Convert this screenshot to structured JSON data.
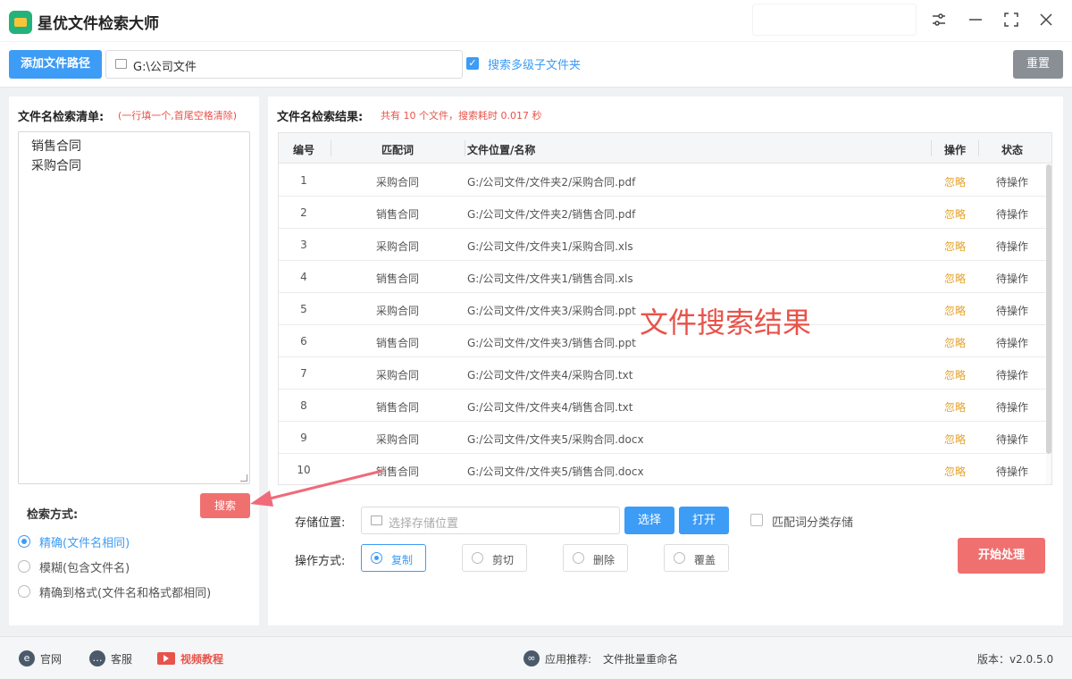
{
  "app": {
    "title": "星优文件检索大师"
  },
  "toolbar": {
    "add_path_label": "添加文件路径",
    "path_value": "G:\\公司文件",
    "subfolder_label": "搜索多级子文件夹",
    "subfolder_checked": true,
    "reset_label": "重置"
  },
  "left": {
    "title": "文件名检索清单:",
    "hint": "(一行填一个,首尾空格清除)",
    "keywords": [
      "销售合同",
      "采购合同"
    ],
    "search_label": "搜索",
    "mode_title": "检索方式:",
    "modes": [
      {
        "label": "精确(文件名相同)",
        "selected": true
      },
      {
        "label": "模糊(包含文件名)",
        "selected": false
      },
      {
        "label": "精确到格式(文件名和格式都相同)",
        "selected": false
      }
    ]
  },
  "results": {
    "title": "文件名检索结果:",
    "summary": "共有 10 个文件，搜索耗时 0.017 秒",
    "columns": [
      "编号",
      "匹配词",
      "文件位置/名称",
      "操作",
      "状态"
    ],
    "rows": [
      {
        "idx": "1",
        "kw": "采购合同",
        "path": "G:/公司文件/文件夹2/采购合同.pdf",
        "op": "忽略",
        "st": "待操作"
      },
      {
        "idx": "2",
        "kw": "销售合同",
        "path": "G:/公司文件/文件夹2/销售合同.pdf",
        "op": "忽略",
        "st": "待操作"
      },
      {
        "idx": "3",
        "kw": "采购合同",
        "path": "G:/公司文件/文件夹1/采购合同.xls",
        "op": "忽略",
        "st": "待操作"
      },
      {
        "idx": "4",
        "kw": "销售合同",
        "path": "G:/公司文件/文件夹1/销售合同.xls",
        "op": "忽略",
        "st": "待操作"
      },
      {
        "idx": "5",
        "kw": "采购合同",
        "path": "G:/公司文件/文件夹3/采购合同.ppt",
        "op": "忽略",
        "st": "待操作"
      },
      {
        "idx": "6",
        "kw": "销售合同",
        "path": "G:/公司文件/文件夹3/销售合同.ppt",
        "op": "忽略",
        "st": "待操作"
      },
      {
        "idx": "7",
        "kw": "采购合同",
        "path": "G:/公司文件/文件夹4/采购合同.txt",
        "op": "忽略",
        "st": "待操作"
      },
      {
        "idx": "8",
        "kw": "销售合同",
        "path": "G:/公司文件/文件夹4/销售合同.txt",
        "op": "忽略",
        "st": "待操作"
      },
      {
        "idx": "9",
        "kw": "采购合同",
        "path": "G:/公司文件/文件夹5/采购合同.docx",
        "op": "忽略",
        "st": "待操作"
      },
      {
        "idx": "10",
        "kw": "销售合同",
        "path": "G:/公司文件/文件夹5/销售合同.docx",
        "op": "忽略",
        "st": "待操作"
      }
    ],
    "overlay_text": "文件搜索结果"
  },
  "storage": {
    "label": "存储位置:",
    "placeholder": "选择存储位置",
    "choose_label": "选择",
    "open_label": "打开",
    "classify_label": "匹配词分类存储",
    "classify_checked": false
  },
  "operation": {
    "label": "操作方式:",
    "options": [
      {
        "label": "复制",
        "selected": true
      },
      {
        "label": "剪切",
        "selected": false
      },
      {
        "label": "删除",
        "selected": false
      },
      {
        "label": "覆盖",
        "selected": false
      }
    ],
    "start_label": "开始处理"
  },
  "footer": {
    "website": "官网",
    "service": "客服",
    "video": "视频教程",
    "recommend_label": "应用推荐:",
    "recommend_app": "文件批量重命名",
    "version": "版本：v2.0.5.0"
  },
  "colors": {
    "accent": "#3d9cf5",
    "danger": "#f07070",
    "warning": "#e5a22a",
    "hint_red": "#e8534a"
  }
}
